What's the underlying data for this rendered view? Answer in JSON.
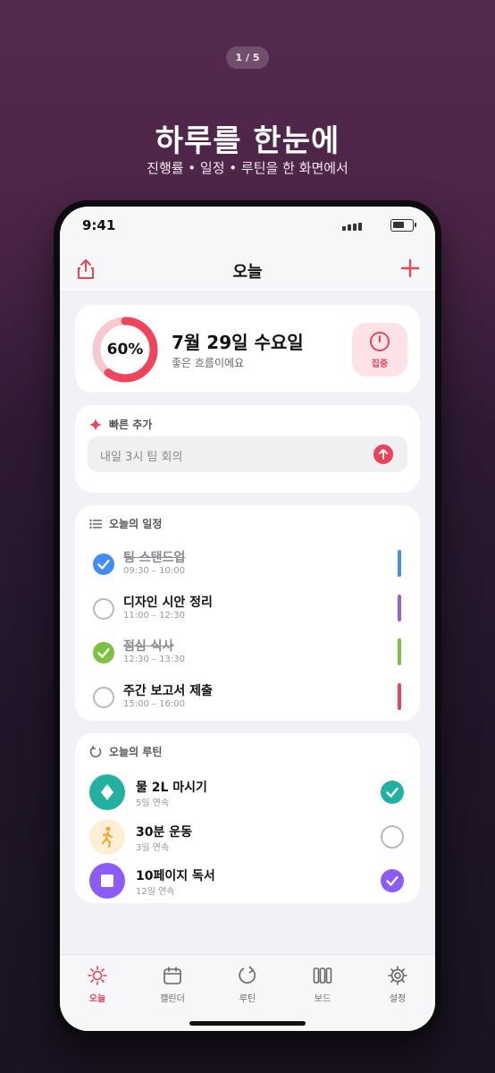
{
  "pager": "1 / 5",
  "hero": {
    "title": "하루를 한눈에",
    "subtitle": "진행률 • 일정 • 루틴을 한 화면에서"
  },
  "status": {
    "time": "9:41"
  },
  "nav": {
    "title": "오늘"
  },
  "summary": {
    "progress_label": "60%",
    "progress_value": 0.6,
    "date": "7월 29일 수요일",
    "message": "좋은 흐름이에요",
    "focus_label": "집중"
  },
  "quick_add": {
    "title": "빠른 추가",
    "placeholder": "내일 3시 팀 회의"
  },
  "schedule": {
    "title": "오늘의 일정",
    "items": [
      {
        "name": "팀 스탠드업",
        "time": "09:30 – 10:00",
        "done": true,
        "check_color": "#3f8df5",
        "bar_color": "#3f8df5"
      },
      {
        "name": "디자인 시안 정리",
        "time": "11:00 – 12:30",
        "done": false,
        "check_color": "",
        "bar_color": "#9b5de5"
      },
      {
        "name": "점심 식사",
        "time": "12:30 – 13:30",
        "done": true,
        "check_color": "#7cc242",
        "bar_color": "#7cc242"
      },
      {
        "name": "주간 보고서 제출",
        "time": "15:00 – 16:00",
        "done": false,
        "check_color": "",
        "bar_color": "#e8445a"
      }
    ]
  },
  "routines": {
    "title": "오늘의 루틴",
    "items": [
      {
        "name": "물 2L 마시기",
        "streak": "5일 연속",
        "icon": "water-drop-icon",
        "icon_bg": "#22b0a0",
        "done": true,
        "check_color": "#22b0a0"
      },
      {
        "name": "30분 운동",
        "streak": "3일 연속",
        "icon": "running-icon",
        "icon_bg": "#fdeed6",
        "done": false,
        "check_color": ""
      },
      {
        "name": "10페이지 독서",
        "streak": "12일 연속",
        "icon": "book-icon",
        "icon_bg": "#8b5cf6",
        "done": true,
        "check_color": "#8b5cf6"
      }
    ]
  },
  "tabs": [
    {
      "label": "오늘",
      "icon": "sun-icon",
      "active": true
    },
    {
      "label": "캘린더",
      "icon": "calendar-icon",
      "active": false
    },
    {
      "label": "루틴",
      "icon": "refresh-icon",
      "active": false
    },
    {
      "label": "보드",
      "icon": "board-icon",
      "active": false
    },
    {
      "label": "설정",
      "icon": "gear-icon",
      "active": false
    }
  ],
  "colors": {
    "accent": "#e8445a",
    "ring_track": "#f7c9cf"
  }
}
